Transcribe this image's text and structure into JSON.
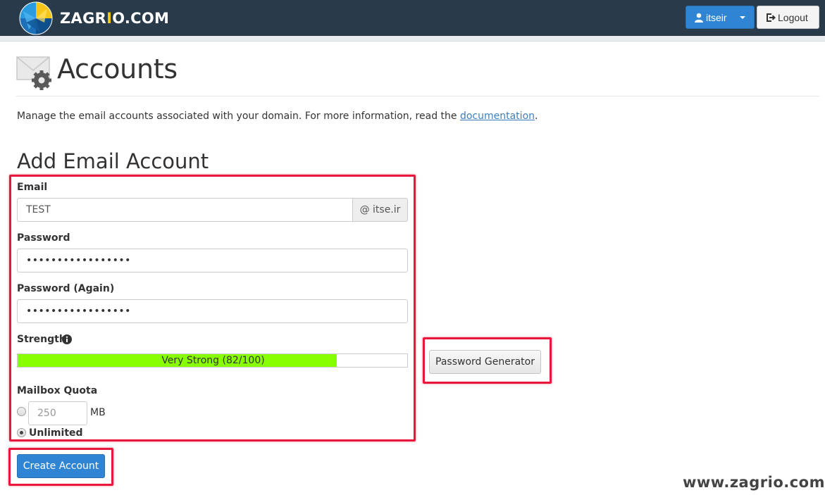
{
  "navbar": {
    "logo_text": "ZAGRIO.COM",
    "user_label": "itseir",
    "logout_label": "Logout"
  },
  "page": {
    "title": "Accounts",
    "intro_text": "Manage the email accounts associated with your domain. For more information, read the",
    "doc_link": "documentation",
    "intro_end": "."
  },
  "form": {
    "section_title": "Add Email Account",
    "email_label": "Email",
    "email_value": "TEST",
    "domain_addon": "@ itse.ir",
    "password_label": "Password",
    "password_value": "•••••••••••••••••",
    "password_again_label": "Password (Again)",
    "password_again_value": "•••••••••••••••••",
    "strength_label": "Strength",
    "strength_text": "Very Strong (82/100)",
    "strength_score": 82,
    "strength_max": 100,
    "strength_color": "#88ff00",
    "quota_label": "Mailbox Quota",
    "quota_placeholder": "250",
    "quota_unit": "MB",
    "quota_unlimited_label": "Unlimited",
    "quota_selected": "unlimited",
    "password_generator_label": "Password Generator",
    "create_label": "Create Account"
  },
  "colors": {
    "navbar": "#293a4a",
    "primary": "#2f85d3",
    "highlight": "#e8173c"
  },
  "watermark": "www.zagrio.com"
}
